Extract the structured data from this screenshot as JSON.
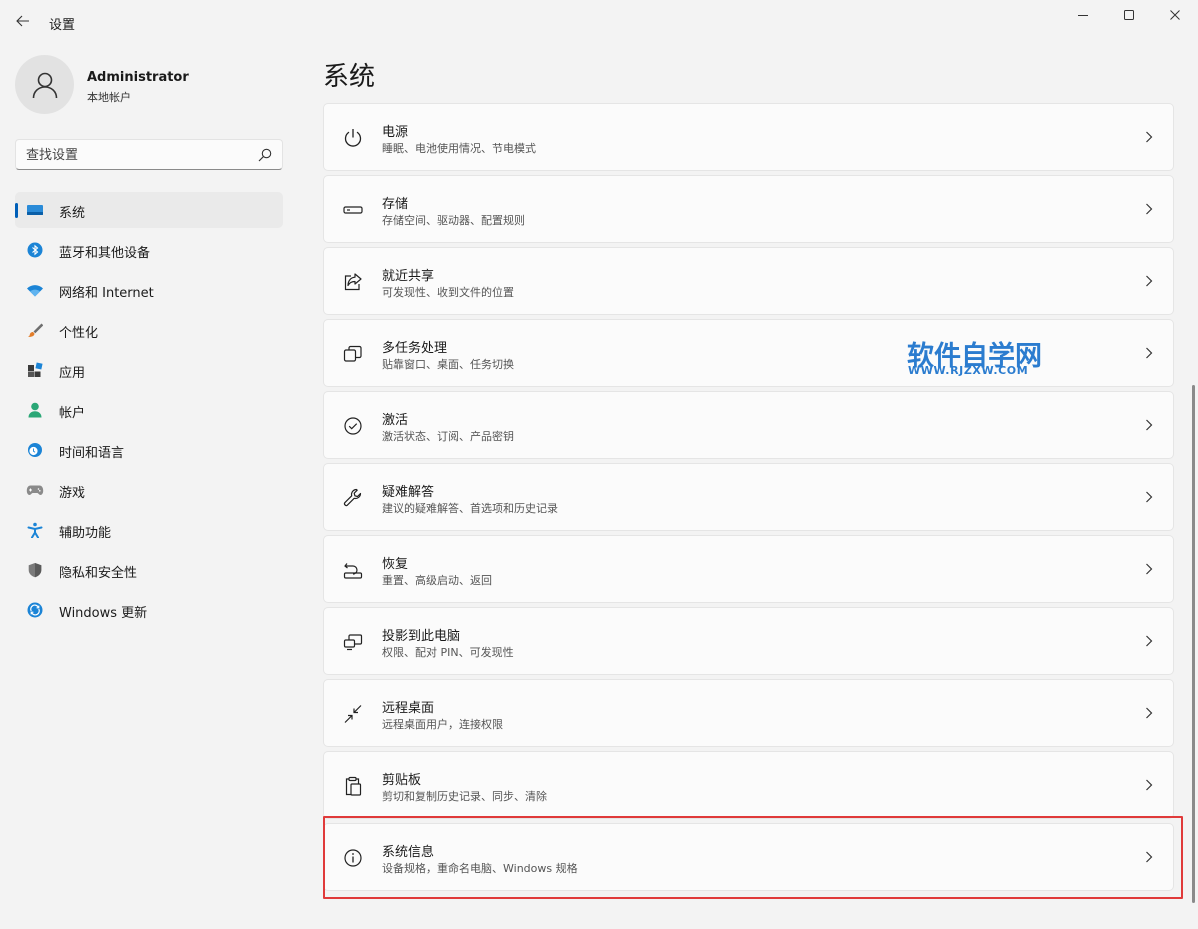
{
  "window": {
    "app_title": "设置",
    "controls": {
      "minimize": "minimize-icon",
      "maximize": "maximize-icon",
      "close": "close-icon"
    }
  },
  "profile": {
    "name": "Administrator",
    "account_type": "本地帐户"
  },
  "search": {
    "placeholder": "查找设置"
  },
  "sidebar": {
    "items": [
      {
        "label": "系统",
        "icon": "system-icon",
        "active": true
      },
      {
        "label": "蓝牙和其他设备",
        "icon": "bluetooth-icon"
      },
      {
        "label": "网络和 Internet",
        "icon": "network-icon"
      },
      {
        "label": "个性化",
        "icon": "personalization-icon"
      },
      {
        "label": "应用",
        "icon": "apps-icon"
      },
      {
        "label": "帐户",
        "icon": "accounts-icon"
      },
      {
        "label": "时间和语言",
        "icon": "time-language-icon"
      },
      {
        "label": "游戏",
        "icon": "gaming-icon"
      },
      {
        "label": "辅助功能",
        "icon": "accessibility-icon"
      },
      {
        "label": "隐私和安全性",
        "icon": "privacy-icon"
      },
      {
        "label": "Windows 更新",
        "icon": "windows-update-icon"
      }
    ]
  },
  "main": {
    "title": "系统",
    "cards": [
      {
        "title": "电源",
        "desc": "睡眠、电池使用情况、节电模式",
        "icon": "power-icon"
      },
      {
        "title": "存储",
        "desc": "存储空间、驱动器、配置规则",
        "icon": "storage-icon"
      },
      {
        "title": "就近共享",
        "desc": "可发现性、收到文件的位置",
        "icon": "share-icon"
      },
      {
        "title": "多任务处理",
        "desc": "贴靠窗口、桌面、任务切换",
        "icon": "multitasking-icon"
      },
      {
        "title": "激活",
        "desc": "激活状态、订阅、产品密钥",
        "icon": "activation-icon"
      },
      {
        "title": "疑难解答",
        "desc": "建议的疑难解答、首选项和历史记录",
        "icon": "troubleshoot-icon"
      },
      {
        "title": "恢复",
        "desc": "重置、高级启动、返回",
        "icon": "recovery-icon"
      },
      {
        "title": "投影到此电脑",
        "desc": "权限、配对 PIN、可发现性",
        "icon": "projection-icon"
      },
      {
        "title": "远程桌面",
        "desc": "远程桌面用户，连接权限",
        "icon": "remote-desktop-icon"
      },
      {
        "title": "剪贴板",
        "desc": "剪切和复制历史记录、同步、清除",
        "icon": "clipboard-icon"
      },
      {
        "title": "系统信息",
        "desc": "设备规格，重命名电脑、Windows 规格",
        "icon": "info-icon",
        "highlighted": true
      }
    ]
  },
  "watermark": {
    "main": "软件自学网",
    "sub": "WWW.RJZXW.COM"
  },
  "colors": {
    "accent": "#005fb8",
    "highlight_border": "#e03a3a",
    "watermark": "#2b7ccf",
    "background": "#f3f3f3",
    "card": "#fbfbfb"
  }
}
